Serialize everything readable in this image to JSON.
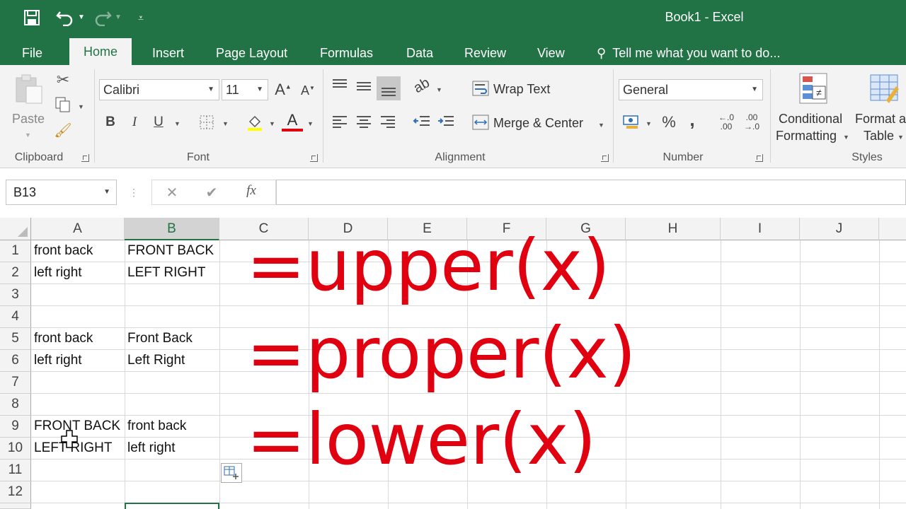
{
  "window": {
    "title": "Book1 - Excel"
  },
  "tabs": [
    "File",
    "Home",
    "Insert",
    "Page Layout",
    "Formulas",
    "Data",
    "Review",
    "View"
  ],
  "tell_me": "Tell me what you want to do...",
  "ribbon": {
    "clipboard": {
      "paste_label": "Paste",
      "group_label": "Clipboard"
    },
    "font": {
      "family": "Calibri",
      "size": "11",
      "group_label": "Font",
      "bold": "B",
      "italic": "I",
      "underline": "U",
      "grow": "A",
      "shrink": "A",
      "font_color": "A"
    },
    "alignment": {
      "wrap_text": "Wrap Text",
      "merge_center": "Merge & Center",
      "group_label": "Alignment"
    },
    "number": {
      "format": "General",
      "percent": "%",
      "comma": ",",
      "inc_decimal_top": "←.0",
      "inc_decimal_bottom": ".00",
      "dec_decimal_top": ".00",
      "dec_decimal_bottom": "→.0",
      "group_label": "Number"
    },
    "styles": {
      "conditional_line1": "Conditional",
      "conditional_line2": "Formatting",
      "format_table_line1": "Format a",
      "format_table_line2": "Table",
      "group_label": "Styles"
    }
  },
  "formula_bar": {
    "name_box": "B13",
    "cancel": "✕",
    "enter": "✔",
    "fx": "fx",
    "content": ""
  },
  "columns": [
    "A",
    "B",
    "C",
    "D",
    "E",
    "F",
    "G",
    "H",
    "I",
    "J"
  ],
  "rows": [
    "1",
    "2",
    "3",
    "4",
    "5",
    "6",
    "7",
    "8",
    "9",
    "10",
    "11",
    "12"
  ],
  "cells": {
    "A1": "front back",
    "B1": "FRONT BACK",
    "A2": "left right",
    "B2": "LEFT RIGHT",
    "A5": "front back",
    "B5": "Front Back",
    "A6": "left right",
    "B6": "Left Right",
    "A9": "FRONT BACK",
    "B9": "front back",
    "A10": "LEFT RIGHT",
    "B10": "left right"
  },
  "overlay_text": {
    "upper": "=upper(x)",
    "proper": "=proper(x)",
    "lower": "=lower(x)"
  },
  "colors": {
    "excel_green": "#217346",
    "annotation_red": "#e00010"
  }
}
